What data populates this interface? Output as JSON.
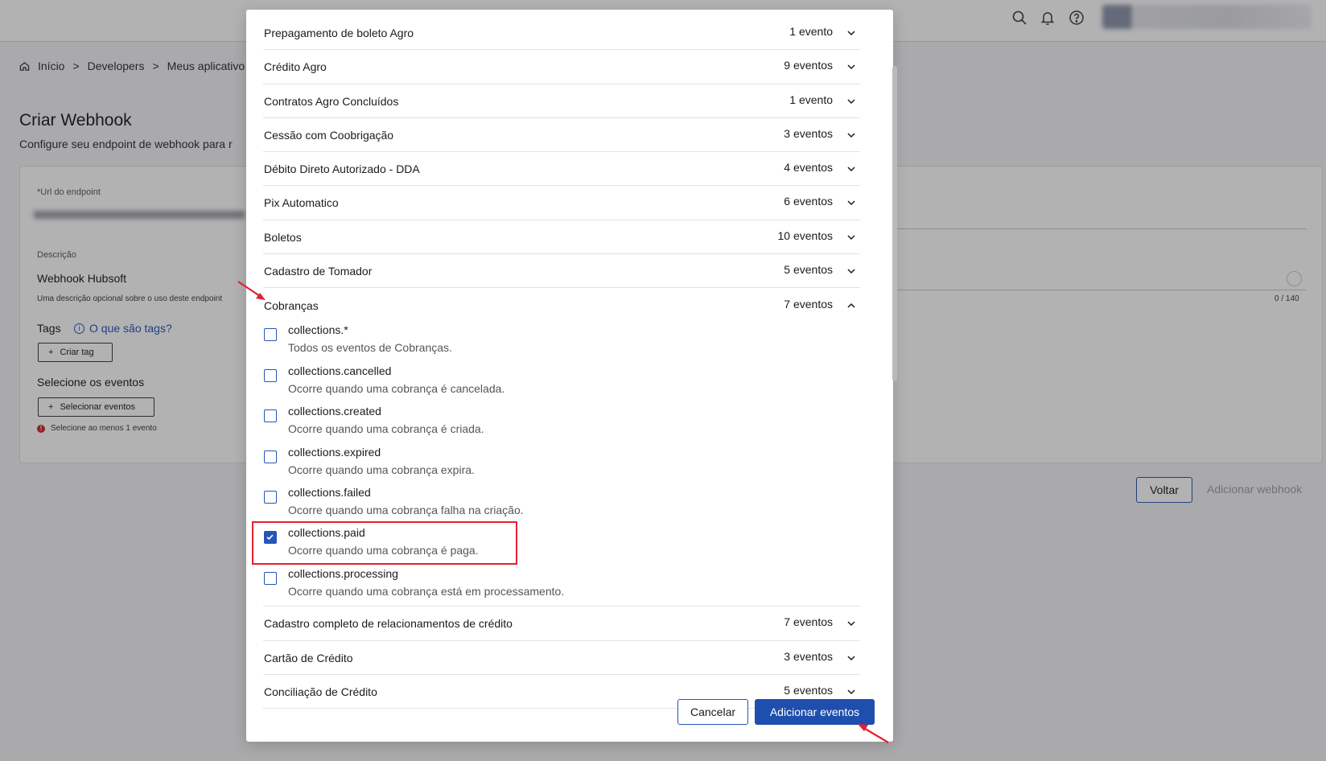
{
  "header": {
    "icons": [
      "search-icon",
      "bell-icon",
      "help-icon"
    ]
  },
  "breadcrumb": {
    "items": [
      "Início",
      "Developers",
      "Meus aplicativo"
    ],
    "separator": ">"
  },
  "page": {
    "title": "Criar Webhook",
    "subtitle": "Configure seu endpoint de webhook para r"
  },
  "form": {
    "url_label": "*Url do endpoint",
    "desc_label": "Descrição",
    "desc_value": "Webhook Hubsoft",
    "desc_help": "Uma descrição opcional sobre o uso deste endpoint",
    "desc_counter": "0 / 140",
    "tags_label": "Tags",
    "tags_help": "O que são tags?",
    "create_tag": "Criar tag",
    "events_label": "Selecione os eventos",
    "select_events": "Selecionar eventos",
    "error": "Selecione ao menos 1 evento"
  },
  "page_actions": {
    "back": "Voltar",
    "add_webhook": "Adicionar webhook"
  },
  "modal": {
    "groups_before": [
      {
        "name": "Prepagamento de boleto Agro",
        "count": "1 evento"
      },
      {
        "name": "Crédito Agro",
        "count": "9 eventos"
      },
      {
        "name": "Contratos Agro Concluídos",
        "count": "1 evento"
      },
      {
        "name": "Cessão com Coobrigação",
        "count": "3 eventos"
      },
      {
        "name": "Débito Direto Autorizado - DDA",
        "count": "4 eventos"
      },
      {
        "name": "Pix Automatico",
        "count": "6 eventos"
      },
      {
        "name": "Boletos",
        "count": "10 eventos"
      },
      {
        "name": "Cadastro de Tomador",
        "count": "5 eventos"
      }
    ],
    "expanded_group": {
      "name": "Cobranças",
      "count": "7 eventos",
      "events": [
        {
          "name": "collections.*",
          "desc": "Todos os eventos de Cobranças.",
          "checked": false
        },
        {
          "name": "collections.cancelled",
          "desc": "Ocorre quando uma cobrança é cancelada.",
          "checked": false
        },
        {
          "name": "collections.created",
          "desc": "Ocorre quando uma cobrança é criada.",
          "checked": false
        },
        {
          "name": "collections.expired",
          "desc": "Ocorre quando uma cobrança expira.",
          "checked": false
        },
        {
          "name": "collections.failed",
          "desc": "Ocorre quando uma cobrança falha na criação.",
          "checked": false
        },
        {
          "name": "collections.paid",
          "desc": "Ocorre quando uma cobrança é paga.",
          "checked": true
        },
        {
          "name": "collections.processing",
          "desc": "Ocorre quando uma cobrança está em processamento.",
          "checked": false
        }
      ]
    },
    "groups_after": [
      {
        "name": "Cadastro completo de relacionamentos de crédito",
        "count": "7 eventos"
      },
      {
        "name": "Cartão de Crédito",
        "count": "3 eventos"
      },
      {
        "name": "Conciliação de Crédito",
        "count": "5 eventos"
      }
    ],
    "cancel": "Cancelar",
    "add_events": "Adicionar eventos"
  },
  "colors": {
    "primary": "#1f4fae",
    "annotation": "#e3202f"
  }
}
